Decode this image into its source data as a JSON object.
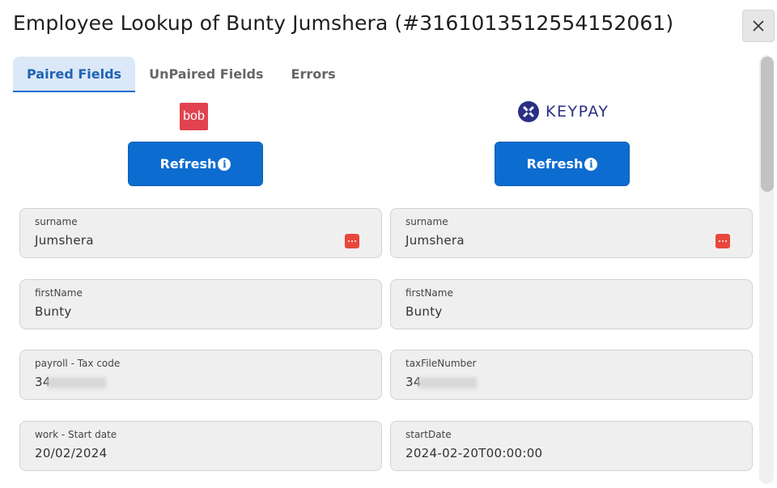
{
  "dialog": {
    "title": "Employee Lookup of Bunty Jumshera (#3161013512554152061)",
    "close_icon": "close-icon"
  },
  "tabs": [
    {
      "label": "Paired Fields",
      "active": true
    },
    {
      "label": "UnPaired Fields",
      "active": false
    },
    {
      "label": "Errors",
      "active": false
    }
  ],
  "left": {
    "logo_text": "bob",
    "refresh_label": "Refresh",
    "fields": [
      {
        "label": "surname",
        "value": "Jumshera",
        "has_menu": true
      },
      {
        "label": "firstName",
        "value": "Bunty"
      },
      {
        "label": "payroll - Tax code",
        "value": "34",
        "redacted": true
      },
      {
        "label": "work - Start date",
        "value": "20/02/2024"
      }
    ]
  },
  "right": {
    "logo_text": "KEYPAY",
    "refresh_label": "Refresh",
    "fields": [
      {
        "label": "surname",
        "value": "Jumshera",
        "has_menu": true
      },
      {
        "label": "firstName",
        "value": "Bunty"
      },
      {
        "label": "taxFileNumber",
        "value": "34",
        "redacted": true
      },
      {
        "label": "startDate",
        "value": "2024-02-20T00:00:00"
      }
    ]
  },
  "colors": {
    "accent": "#0d6ccf",
    "bob": "#e0434f",
    "keypay": "#2b2f85",
    "menu_button": "#e8473b"
  }
}
